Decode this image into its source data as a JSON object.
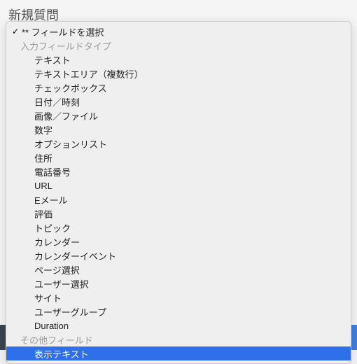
{
  "header": {
    "title": "新規質問"
  },
  "dropdown": {
    "selected_label": "** フィールドを選択",
    "groups": [
      {
        "label": "入力フィールドタイプ",
        "options": [
          "テキスト",
          "テキストエリア（複数行）",
          "チェックボックス",
          "日付／時刻",
          "画像／ファイル",
          "数字",
          "オプションリスト",
          "住所",
          "電話番号",
          "URL",
          "Eメール",
          "評価",
          "トピック",
          "カレンダー",
          "カレンダーイベント",
          "ページ選択",
          "ユーザー選択",
          "サイト",
          "ユーザーグループ",
          "Duration"
        ]
      },
      {
        "label": "その他フィールド",
        "options": [
          "表示テキスト"
        ]
      }
    ],
    "highlighted": "表示テキスト"
  }
}
